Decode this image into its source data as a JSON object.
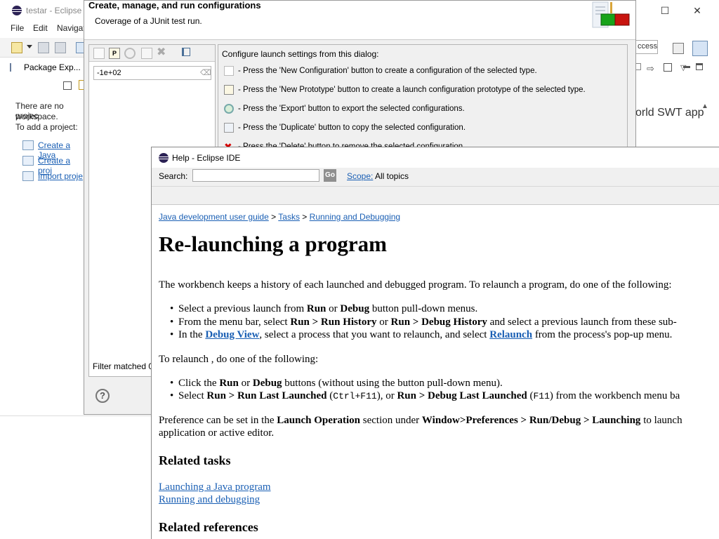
{
  "eclipse": {
    "title": "testar - Eclipse I",
    "menu": [
      "File",
      "Edit",
      "Navigat"
    ],
    "package_tab": "Package Exp...",
    "no_projects_line1": "There are no projec",
    "no_projects_line2": "workspace.",
    "add_project": "To add a project:",
    "links": [
      "Create a Java",
      "Create a proj",
      "Import proje"
    ],
    "quick_access": "ccess",
    "swt_text": "orld SWT app"
  },
  "launch": {
    "title": "Create, manage, and run configurations",
    "subtitle": "Coverage of a JUnit test run.",
    "filter_value": "-1e+02",
    "filter_status": "Filter matched 0",
    "intro": "Configure launch settings from this dialog:",
    "instructions": [
      "- Press the 'New Configuration' button to create a configuration of the selected type.",
      "- Press the 'New Prototype' button to create a launch configuration prototype of the selected type.",
      "- Press the 'Export' button to export the selected configurations.",
      "- Press the 'Duplicate' button to copy the selected configuration.",
      "- Press the 'Delete' button to remove the selected configuration."
    ],
    "help_glyph": "?"
  },
  "help": {
    "title": "Help - Eclipse IDE",
    "search_label": "Search:",
    "go_label": "Go",
    "scope_label": "Scope:",
    "scope_value": "All topics",
    "breadcrumb": [
      "Java development user guide",
      "Tasks",
      "Running and Debugging"
    ],
    "breadcrumb_sep": ">",
    "heading": "Re-launching a program",
    "intro": "The workbench keeps a history of each launched and debugged program. To relaunch a program, do one of the following:",
    "b1": {
      "a": "Select a previous launch from ",
      "run": "Run",
      "or": " or ",
      "debug": "Debug",
      "rest": " button pull-down menus."
    },
    "b2": {
      "a": "From the menu bar, select ",
      "rh": "Run > Run History",
      "or": " or ",
      "dh": "Run > Debug History",
      "rest": " and select a previous launch from these sub-"
    },
    "b3": {
      "a": "In the ",
      "dv": "Debug View",
      "mid": ", select a process that you want to relaunch, and select ",
      "rl": "Relaunch",
      "rest": " from the process's pop-up menu."
    },
    "relaunch_intro": "To relaunch , do one of the following:",
    "c1": {
      "a": "Click the ",
      "run": "Run",
      "or": " or ",
      "debug": "Debug",
      "rest": " buttons (without using the button pull-down menu)."
    },
    "c2": {
      "a": "Select ",
      "rll": "Run > Run Last Launched",
      "k1": "Ctrl+F11",
      "or": ", or ",
      "dll": "Run > Debug Last Launched",
      "k2": "F11",
      "rest": " from the workbench menu ba"
    },
    "pref": {
      "a": "Preference can be set in the ",
      "lo": "Launch Operation",
      "b": " section under ",
      "wp": "Window>Preferences > Run/Debug > Launching",
      "c": " to launch",
      "line2": "application or active editor."
    },
    "related_tasks": "Related tasks",
    "task_links": [
      "Launching a Java program",
      "Running and debugging"
    ],
    "related_refs": "Related references"
  }
}
